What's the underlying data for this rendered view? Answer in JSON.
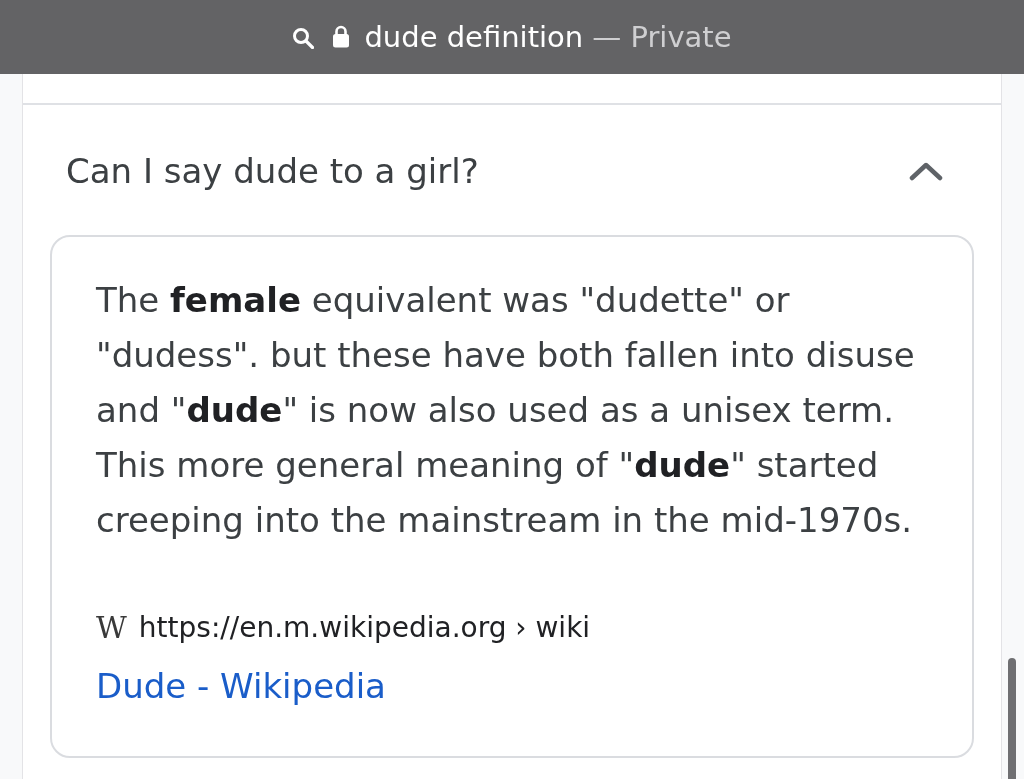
{
  "address_bar": {
    "query": "dude definition",
    "mode": "— Private"
  },
  "faq": {
    "question": "Can I say dude to a girl?",
    "expanded": true,
    "answer": "The **female** equivalent was \"dudette\" or \"dudess\". but these have both fallen into disuse and \"**dude**\" is now also used as a unisex term. This more general meaning of \"**dude**\" started creeping into the mainstream in the mid-1970s.",
    "source": {
      "icon": "W",
      "url": "https://en.m.wikipedia.org › wiki",
      "title": "Dude - Wikipedia"
    }
  }
}
